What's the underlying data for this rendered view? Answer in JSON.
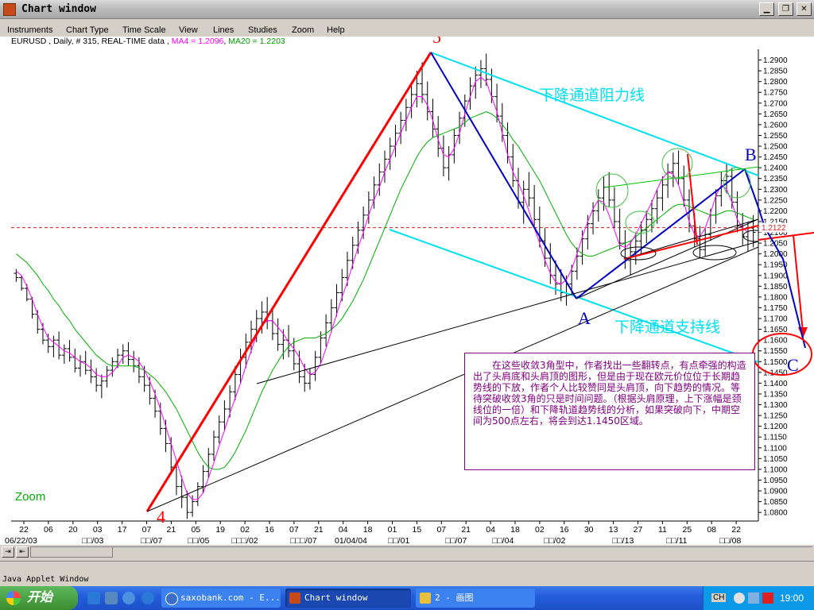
{
  "window": {
    "title": "Chart window"
  },
  "menu": [
    "Instruments",
    "Chart Type",
    "Time Scale",
    "View",
    "Lines",
    "Studies",
    "Zoom",
    "Help"
  ],
  "info": {
    "symbol": "EURUSD , Daily, # 315, REAL-TIME data ,",
    "ma4": "MA4 = 1.2096",
    "ma20": "MA20 = 1.2203"
  },
  "colors": {
    "candles": "#000000",
    "ma4": "#ff00ff",
    "ma20": "#00b000",
    "trend_red": "#ff0000",
    "trend_blue": "#0000c8",
    "channel": "#00e0f0",
    "annotation": "#800080",
    "current_price": "#e02020"
  },
  "chart_data": {
    "type": "candlestick",
    "price_ticks": [
      "1.2900",
      "1.2850",
      "1.2800",
      "1.2750",
      "1.2700",
      "1.2650",
      "1.2600",
      "1.2550",
      "1.2500",
      "1.2450",
      "1.2400",
      "1.2350",
      "1.2300",
      "1.2250",
      "1.2200",
      "1.2150",
      "1.2100",
      "1.2050",
      "1.2000",
      "1.1950",
      "1.1900",
      "1.1850",
      "1.1800",
      "1.1750",
      "1.1700",
      "1.1650",
      "1.1600",
      "1.1550",
      "1.1500",
      "1.1450",
      "1.1400",
      "1.1350",
      "1.1300",
      "1.1250",
      "1.1200",
      "1.1150",
      "1.1100",
      "1.1050",
      "1.1000",
      "1.0950",
      "1.0900",
      "1.0850",
      "1.0800"
    ],
    "ylim": [
      1.076,
      1.295
    ],
    "current_price": "1.2122",
    "current_price_value": 1.2122,
    "date_ticks": [
      "22",
      "06",
      "20",
      "03",
      "17",
      "07",
      "21",
      "05",
      "19",
      "02",
      "16",
      "07",
      "21",
      "04",
      "18",
      "01",
      "15",
      "07",
      "21",
      "04",
      "18",
      "02",
      "16",
      "30",
      "13",
      "27",
      "11",
      "25",
      "08",
      "22"
    ],
    "month_labels": [
      "06/22/03",
      "□□/03",
      "□□/07",
      "□□/05",
      "□□□/02",
      "□□□/07",
      "01/04/04",
      "□□/01",
      "□□/07",
      "□□/04",
      "□□/02",
      "□□/13",
      "□□/11",
      "□□/08"
    ],
    "ohlc_estimated": [
      [
        1.191,
        1.193,
        1.187,
        1.189
      ],
      [
        1.189,
        1.19,
        1.183,
        1.184
      ],
      [
        1.184,
        1.186,
        1.178,
        1.179
      ],
      [
        1.179,
        1.18,
        1.17,
        1.172
      ],
      [
        1.172,
        1.174,
        1.163,
        1.165
      ],
      [
        1.165,
        1.168,
        1.158,
        1.16
      ],
      [
        1.16,
        1.163,
        1.154,
        1.157
      ],
      [
        1.157,
        1.162,
        1.152,
        1.16
      ],
      [
        1.16,
        1.164,
        1.151,
        1.153
      ],
      [
        1.153,
        1.158,
        1.149,
        1.156
      ],
      [
        1.156,
        1.16,
        1.15,
        1.152
      ],
      [
        1.152,
        1.156,
        1.145,
        1.147
      ],
      [
        1.147,
        1.153,
        1.143,
        1.15
      ],
      [
        1.15,
        1.155,
        1.144,
        1.146
      ],
      [
        1.146,
        1.151,
        1.14,
        1.143
      ],
      [
        1.143,
        1.147,
        1.136,
        1.139
      ],
      [
        1.139,
        1.144,
        1.133,
        1.141
      ],
      [
        1.141,
        1.148,
        1.138,
        1.146
      ],
      [
        1.146,
        1.152,
        1.143,
        1.15
      ],
      [
        1.15,
        1.156,
        1.147,
        1.153
      ],
      [
        1.153,
        1.158,
        1.149,
        1.155
      ],
      [
        1.155,
        1.159,
        1.148,
        1.151
      ],
      [
        1.151,
        1.155,
        1.145,
        1.148
      ],
      [
        1.148,
        1.152,
        1.14,
        1.143
      ],
      [
        1.143,
        1.148,
        1.136,
        1.139
      ],
      [
        1.139,
        1.143,
        1.13,
        1.133
      ],
      [
        1.133,
        1.137,
        1.124,
        1.127
      ],
      [
        1.127,
        1.131,
        1.116,
        1.119
      ],
      [
        1.119,
        1.123,
        1.108,
        1.112
      ],
      [
        1.112,
        1.115,
        1.098,
        1.101
      ],
      [
        1.101,
        1.104,
        1.088,
        1.092
      ],
      [
        1.092,
        1.097,
        1.082,
        1.087
      ],
      [
        1.087,
        1.09,
        1.077,
        1.08
      ],
      [
        1.08,
        1.088,
        1.078,
        1.085
      ],
      [
        1.085,
        1.094,
        1.083,
        1.092
      ],
      [
        1.092,
        1.102,
        1.089,
        1.099
      ],
      [
        1.099,
        1.11,
        1.096,
        1.107
      ],
      [
        1.107,
        1.118,
        1.104,
        1.115
      ],
      [
        1.115,
        1.125,
        1.112,
        1.122
      ],
      [
        1.122,
        1.132,
        1.118,
        1.128
      ],
      [
        1.128,
        1.139,
        1.124,
        1.136
      ],
      [
        1.136,
        1.148,
        1.132,
        1.144
      ],
      [
        1.144,
        1.156,
        1.14,
        1.152
      ],
      [
        1.152,
        1.163,
        1.147,
        1.159
      ],
      [
        1.159,
        1.169,
        1.154,
        1.165
      ],
      [
        1.165,
        1.174,
        1.159,
        1.17
      ],
      [
        1.17,
        1.178,
        1.163,
        1.173
      ],
      [
        1.173,
        1.18,
        1.165,
        1.169
      ],
      [
        1.169,
        1.175,
        1.16,
        1.163
      ],
      [
        1.163,
        1.17,
        1.155,
        1.158
      ],
      [
        1.158,
        1.165,
        1.151,
        1.16
      ],
      [
        1.16,
        1.167,
        1.152,
        1.155
      ],
      [
        1.155,
        1.161,
        1.146,
        1.149
      ],
      [
        1.149,
        1.155,
        1.14,
        1.143
      ],
      [
        1.143,
        1.149,
        1.136,
        1.14
      ],
      [
        1.14,
        1.147,
        1.137,
        1.144
      ],
      [
        1.144,
        1.155,
        1.141,
        1.152
      ],
      [
        1.152,
        1.164,
        1.149,
        1.161
      ],
      [
        1.161,
        1.172,
        1.157,
        1.168
      ],
      [
        1.168,
        1.179,
        1.164,
        1.175
      ],
      [
        1.175,
        1.186,
        1.171,
        1.182
      ],
      [
        1.182,
        1.193,
        1.178,
        1.189
      ],
      [
        1.189,
        1.201,
        1.185,
        1.197
      ],
      [
        1.197,
        1.208,
        1.193,
        1.204
      ],
      [
        1.204,
        1.215,
        1.2,
        1.211
      ],
      [
        1.211,
        1.222,
        1.207,
        1.218
      ],
      [
        1.218,
        1.229,
        1.214,
        1.225
      ],
      [
        1.225,
        1.236,
        1.221,
        1.232
      ],
      [
        1.232,
        1.242,
        1.227,
        1.238
      ],
      [
        1.238,
        1.248,
        1.233,
        1.244
      ],
      [
        1.244,
        1.254,
        1.239,
        1.25
      ],
      [
        1.25,
        1.26,
        1.245,
        1.256
      ],
      [
        1.256,
        1.266,
        1.251,
        1.262
      ],
      [
        1.262,
        1.272,
        1.257,
        1.268
      ],
      [
        1.268,
        1.279,
        1.263,
        1.274
      ],
      [
        1.274,
        1.285,
        1.268,
        1.279
      ],
      [
        1.279,
        1.289,
        1.27,
        1.274
      ],
      [
        1.274,
        1.28,
        1.262,
        1.266
      ],
      [
        1.266,
        1.272,
        1.254,
        1.258
      ],
      [
        1.258,
        1.264,
        1.245,
        1.249
      ],
      [
        1.249,
        1.255,
        1.236,
        1.24
      ],
      [
        1.24,
        1.25,
        1.234,
        1.246
      ],
      [
        1.246,
        1.258,
        1.242,
        1.255
      ],
      [
        1.255,
        1.266,
        1.251,
        1.263
      ],
      [
        1.263,
        1.274,
        1.259,
        1.271
      ],
      [
        1.271,
        1.282,
        1.267,
        1.278
      ],
      [
        1.278,
        1.287,
        1.272,
        1.283
      ],
      [
        1.283,
        1.29,
        1.277,
        1.286
      ],
      [
        1.286,
        1.293,
        1.278,
        1.281
      ],
      [
        1.281,
        1.286,
        1.27,
        1.273
      ],
      [
        1.273,
        1.279,
        1.261,
        1.264
      ],
      [
        1.264,
        1.27,
        1.252,
        1.255
      ],
      [
        1.255,
        1.261,
        1.242,
        1.245
      ],
      [
        1.245,
        1.251,
        1.231,
        1.234
      ],
      [
        1.234,
        1.24,
        1.221,
        1.224
      ],
      [
        1.224,
        1.234,
        1.214,
        1.23
      ],
      [
        1.23,
        1.238,
        1.222,
        1.226
      ],
      [
        1.226,
        1.232,
        1.213,
        1.216
      ],
      [
        1.216,
        1.222,
        1.203,
        1.206
      ],
      [
        1.206,
        1.212,
        1.194,
        1.198
      ],
      [
        1.198,
        1.205,
        1.186,
        1.19
      ],
      [
        1.19,
        1.197,
        1.181,
        1.186
      ],
      [
        1.186,
        1.193,
        1.178,
        1.182
      ],
      [
        1.182,
        1.19,
        1.176,
        1.186
      ],
      [
        1.186,
        1.195,
        1.181,
        1.192
      ],
      [
        1.192,
        1.203,
        1.188,
        1.199
      ],
      [
        1.199,
        1.211,
        1.195,
        1.207
      ],
      [
        1.207,
        1.218,
        1.202,
        1.214
      ],
      [
        1.214,
        1.224,
        1.209,
        1.22
      ],
      [
        1.22,
        1.23,
        1.215,
        1.226
      ],
      [
        1.226,
        1.236,
        1.22,
        1.231
      ],
      [
        1.231,
        1.238,
        1.222,
        1.225
      ],
      [
        1.225,
        1.231,
        1.212,
        1.215
      ],
      [
        1.215,
        1.221,
        1.202,
        1.205
      ],
      [
        1.205,
        1.211,
        1.193,
        1.197
      ],
      [
        1.197,
        1.206,
        1.19,
        1.201
      ],
      [
        1.201,
        1.21,
        1.195,
        1.206
      ],
      [
        1.206,
        1.215,
        1.2,
        1.211
      ],
      [
        1.211,
        1.22,
        1.205,
        1.216
      ],
      [
        1.216,
        1.225,
        1.21,
        1.221
      ],
      [
        1.221,
        1.23,
        1.214,
        1.226
      ],
      [
        1.226,
        1.236,
        1.22,
        1.232
      ],
      [
        1.232,
        1.242,
        1.226,
        1.238
      ],
      [
        1.238,
        1.247,
        1.231,
        1.242
      ],
      [
        1.242,
        1.248,
        1.232,
        1.235
      ],
      [
        1.235,
        1.241,
        1.222,
        1.225
      ],
      [
        1.225,
        1.23,
        1.21,
        1.213
      ],
      [
        1.213,
        1.219,
        1.203,
        1.207
      ],
      [
        1.207,
        1.213,
        1.198,
        1.202
      ],
      [
        1.202,
        1.212,
        1.199,
        1.209
      ],
      [
        1.209,
        1.221,
        1.206,
        1.218
      ],
      [
        1.218,
        1.23,
        1.214,
        1.227
      ],
      [
        1.227,
        1.238,
        1.222,
        1.234
      ],
      [
        1.234,
        1.242,
        1.228,
        1.236
      ],
      [
        1.236,
        1.24,
        1.221,
        1.224
      ],
      [
        1.224,
        1.229,
        1.21,
        1.213
      ],
      [
        1.213,
        1.219,
        1.204,
        1.208
      ],
      [
        1.208,
        1.215,
        1.201,
        1.212
      ],
      [
        1.212,
        1.218,
        1.203,
        1.21
      ]
    ],
    "ma4": [
      1.192,
      1.19,
      1.185,
      1.179,
      1.172,
      1.166,
      1.161,
      1.159,
      1.157,
      1.155,
      1.154,
      1.152,
      1.15,
      1.149,
      1.147,
      1.144,
      1.143,
      1.143,
      1.145,
      1.148,
      1.152,
      1.153,
      1.152,
      1.15,
      1.146,
      1.141,
      1.135,
      1.128,
      1.12,
      1.112,
      1.104,
      1.096,
      1.089,
      1.086,
      1.086,
      1.089,
      1.096,
      1.103,
      1.111,
      1.118,
      1.126,
      1.133,
      1.14,
      1.148,
      1.155,
      1.162,
      1.167,
      1.169,
      1.169,
      1.166,
      1.163,
      1.159,
      1.156,
      1.152,
      1.147,
      1.144,
      1.145,
      1.149,
      1.156,
      1.164,
      1.172,
      1.18,
      1.187,
      1.195,
      1.203,
      1.21,
      1.218,
      1.225,
      1.231,
      1.238,
      1.244,
      1.25,
      1.256,
      1.262,
      1.268,
      1.273,
      1.273,
      1.269,
      1.262,
      1.253,
      1.246,
      1.245,
      1.249,
      1.256,
      1.265,
      1.273,
      1.28,
      1.282,
      1.28,
      1.273,
      1.266,
      1.256,
      1.246,
      1.238,
      1.233,
      1.227,
      1.22,
      1.212,
      1.205,
      1.197,
      1.191,
      1.187,
      1.186,
      1.188,
      1.193,
      1.2,
      1.208,
      1.215,
      1.221,
      1.225,
      1.224,
      1.218,
      1.211,
      1.204,
      1.203,
      1.205,
      1.209,
      1.214,
      1.219,
      1.224,
      1.23,
      1.235,
      1.238,
      1.237,
      1.232,
      1.224,
      1.215,
      1.209,
      1.208,
      1.212,
      1.219,
      1.227,
      1.232,
      1.23,
      1.224,
      1.216,
      1.212,
      1.21
    ],
    "ma20": [
      1.2,
      1.198,
      1.196,
      1.193,
      1.19,
      1.186,
      1.183,
      1.179,
      1.176,
      1.172,
      1.169,
      1.165,
      1.162,
      1.159,
      1.156,
      1.153,
      1.151,
      1.149,
      1.148,
      1.148,
      1.148,
      1.148,
      1.148,
      1.147,
      1.146,
      1.144,
      1.142,
      1.139,
      1.136,
      1.132,
      1.128,
      1.123,
      1.118,
      1.113,
      1.108,
      1.104,
      1.101,
      1.1,
      1.1,
      1.101,
      1.104,
      1.108,
      1.113,
      1.118,
      1.124,
      1.13,
      1.136,
      1.141,
      1.146,
      1.15,
      1.154,
      1.157,
      1.159,
      1.16,
      1.161,
      1.161,
      1.161,
      1.162,
      1.163,
      1.165,
      1.167,
      1.17,
      1.174,
      1.178,
      1.183,
      1.188,
      1.194,
      1.2,
      1.206,
      1.212,
      1.218,
      1.224,
      1.23,
      1.235,
      1.24,
      1.245,
      1.249,
      1.252,
      1.254,
      1.255,
      1.256,
      1.257,
      1.258,
      1.259,
      1.261,
      1.263,
      1.264,
      1.265,
      1.266,
      1.265,
      1.263,
      1.26,
      1.257,
      1.253,
      1.25,
      1.246,
      1.242,
      1.238,
      1.234,
      1.229,
      1.224,
      1.219,
      1.214,
      1.209,
      1.205,
      1.202,
      1.2,
      1.199,
      1.199,
      1.2,
      1.201,
      1.202,
      1.203,
      1.204,
      1.205,
      1.206,
      1.208,
      1.21,
      1.212,
      1.214,
      1.216,
      1.218,
      1.22,
      1.222,
      1.223,
      1.223,
      1.222,
      1.221,
      1.22,
      1.219,
      1.218,
      1.218,
      1.219,
      1.22,
      1.22,
      1.219,
      1.218,
      1.217,
      1.216
    ]
  },
  "labels": {
    "wave_5": "5",
    "wave_4": "4",
    "point_a": "A",
    "point_b": "B",
    "point_c": "C",
    "resistance": "下降通道阻力线",
    "support": "下降通道支持线",
    "zoom": "Zoom",
    "annotation": "在这些收敛3角型中，作者找出一些翻转点，有点牵强的构造出了头肩底和头肩顶的图形，但是由于现在欧元价位位于长期趋势线的下放，作者个人比较赞同是头肩顶，向下趋势的情况。等待突破收敛3角的只是时间问题。（根据头肩原理，上下涨幅是颈线位的一倍）和下降轨道趋势线的分析，如果突破向下，中期空间为500点左右，将会到达1.1450区域。"
  },
  "status": {
    "applet": "Java Applet Window"
  },
  "taskbar": {
    "start": "开始",
    "tasks": [
      "saxobank.com - E...",
      "Chart window",
      "2 - 画图"
    ],
    "lang": "CH",
    "clock": "19:00"
  }
}
